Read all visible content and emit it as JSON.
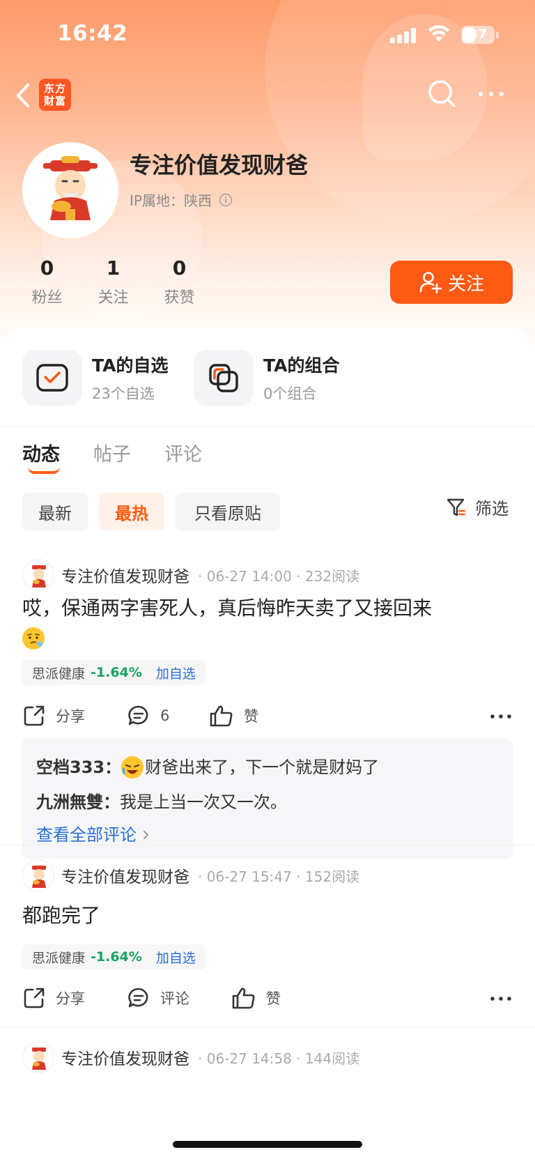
{
  "status_bar": {
    "time": "16:42",
    "battery": "37"
  },
  "nav": {
    "brand_logo_text": "东方财富"
  },
  "profile": {
    "name": "专注价值发现财爸",
    "ip_location": "IP属地：陕西",
    "stats": [
      {
        "value": "0",
        "label": "粉丝"
      },
      {
        "value": "1",
        "label": "关注"
      },
      {
        "value": "0",
        "label": "获赞"
      }
    ],
    "follow_label": "关注"
  },
  "entries": [
    {
      "title": "TA的自选",
      "sub": "23个自选"
    },
    {
      "title": "TA的组合",
      "sub": "0个组合"
    }
  ],
  "tabs": [
    "动态",
    "帖子",
    "评论"
  ],
  "filters": {
    "chips": [
      "最新",
      "最热",
      "只看原贴"
    ],
    "active": "最热",
    "filter_label": "筛选"
  },
  "posts": [
    {
      "author": "专注价值发现财爸",
      "meta": "· 06-27 14:00 · 232阅读",
      "text": "哎，保通两字害死人，真后悔昨天卖了又接回来",
      "stock": {
        "name": "思派健康",
        "change": "-1.64%",
        "add_label": "加自选"
      },
      "actions": {
        "share": "分享",
        "comment": "6",
        "like": "赞"
      },
      "comments": [
        {
          "user": "空档333：",
          "text": "财爸出来了，下一个就是财妈了"
        },
        {
          "user": "九洲無雙：",
          "text": "我是上当一次又一次。"
        }
      ],
      "view_all": "查看全部评论"
    },
    {
      "author": "专注价值发现财爸",
      "meta": "· 06-27 15:47 · 152阅读",
      "text": "都跑完了",
      "stock": {
        "name": "思派健康",
        "change": "-1.64%",
        "add_label": "加自选"
      },
      "actions": {
        "share": "分享",
        "comment": "评论",
        "like": "赞"
      }
    },
    {
      "author": "专注价值发现财爸",
      "meta": "· 06-27 14:58 · 144阅读"
    }
  ],
  "colors": {
    "accent": "#ff5a14",
    "down_green": "#19a15f",
    "link_blue": "#2b6fd6"
  }
}
